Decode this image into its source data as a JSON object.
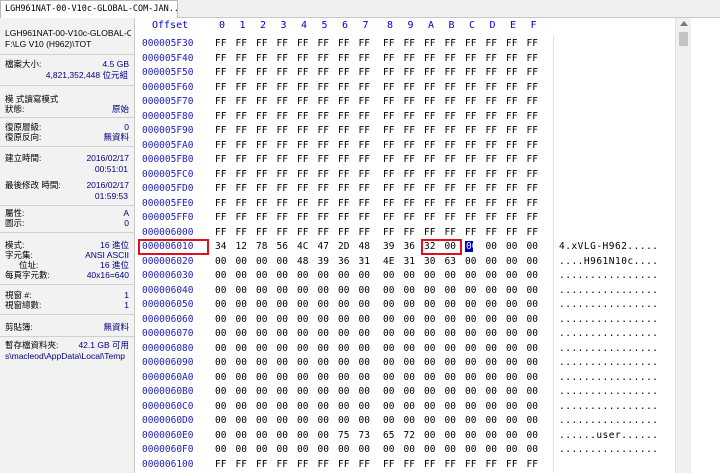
{
  "tab": {
    "title": "LGH961NAT-00-V10c-GLOBAL-COM-JAN..."
  },
  "side": {
    "file_name": "LGH961NAT-00-V10c-GLOBAL-C",
    "file_path": "F:\\LG V10 (H962)\\TOT",
    "size_label": "檔案大小:",
    "size_gb": "4.5 GB",
    "size_bytes": "4,821,352,448 位元組",
    "mode_label": "模   式讀寫模式",
    "state_label": "狀態:",
    "state_value": "原始",
    "undo_level_label": "復原層級:",
    "undo_level_value": "0",
    "undo_rev_label": "復原反向:",
    "undo_rev_value": "無資料",
    "created_label": "建立時間:",
    "created_date": "2016/02/17",
    "created_time": "00:51:01",
    "modified_label": "最後修改   時間:",
    "modified_date": "2016/02/17",
    "modified_time": "01:59:53",
    "attr_label": "屬性:",
    "attr_value": "A",
    "icon_label": "圖示:",
    "icon_value": "0",
    "mode2_label": "模式:",
    "mode2_value": "16 進位",
    "charset_label": "字元集:",
    "charset_value": "ANSI ASCII",
    "offset_label": "位址:",
    "offset_value": "16 進位",
    "bpp_label": "每頁字元數:",
    "bpp_value": "40x16=640",
    "window_label": "視窗 #:",
    "window_value": "1",
    "window_count_label": "視窗總數:",
    "window_count_value": "1",
    "clipboard_label": "剪貼簿:",
    "clipboard_value": "無資料",
    "temp_label": "暫存檔資料夾:",
    "temp_value": "42.1 GB 可用",
    "temp_path": "s\\macleod\\AppData\\Local\\Temp"
  },
  "hex": {
    "header_offset": "Offset",
    "columns": [
      "0",
      "1",
      "2",
      "3",
      "4",
      "5",
      "6",
      "7",
      "8",
      "9",
      "A",
      "B",
      "C",
      "D",
      "E",
      "F"
    ],
    "rows": [
      {
        "offset": "000005F30",
        "bytes": [
          "FF",
          "FF",
          "FF",
          "FF",
          "FF",
          "FF",
          "FF",
          "FF",
          "FF",
          "FF",
          "FF",
          "FF",
          "FF",
          "FF",
          "FF",
          "FF"
        ],
        "ascii": ""
      },
      {
        "offset": "000005F40",
        "bytes": [
          "FF",
          "FF",
          "FF",
          "FF",
          "FF",
          "FF",
          "FF",
          "FF",
          "FF",
          "FF",
          "FF",
          "FF",
          "FF",
          "FF",
          "FF",
          "FF"
        ],
        "ascii": ""
      },
      {
        "offset": "000005F50",
        "bytes": [
          "FF",
          "FF",
          "FF",
          "FF",
          "FF",
          "FF",
          "FF",
          "FF",
          "FF",
          "FF",
          "FF",
          "FF",
          "FF",
          "FF",
          "FF",
          "FF"
        ],
        "ascii": ""
      },
      {
        "offset": "000005F60",
        "bytes": [
          "FF",
          "FF",
          "FF",
          "FF",
          "FF",
          "FF",
          "FF",
          "FF",
          "FF",
          "FF",
          "FF",
          "FF",
          "FF",
          "FF",
          "FF",
          "FF"
        ],
        "ascii": ""
      },
      {
        "offset": "000005F70",
        "bytes": [
          "FF",
          "FF",
          "FF",
          "FF",
          "FF",
          "FF",
          "FF",
          "FF",
          "FF",
          "FF",
          "FF",
          "FF",
          "FF",
          "FF",
          "FF",
          "FF"
        ],
        "ascii": ""
      },
      {
        "offset": "000005F80",
        "bytes": [
          "FF",
          "FF",
          "FF",
          "FF",
          "FF",
          "FF",
          "FF",
          "FF",
          "FF",
          "FF",
          "FF",
          "FF",
          "FF",
          "FF",
          "FF",
          "FF"
        ],
        "ascii": ""
      },
      {
        "offset": "000005F90",
        "bytes": [
          "FF",
          "FF",
          "FF",
          "FF",
          "FF",
          "FF",
          "FF",
          "FF",
          "FF",
          "FF",
          "FF",
          "FF",
          "FF",
          "FF",
          "FF",
          "FF"
        ],
        "ascii": ""
      },
      {
        "offset": "000005FA0",
        "bytes": [
          "FF",
          "FF",
          "FF",
          "FF",
          "FF",
          "FF",
          "FF",
          "FF",
          "FF",
          "FF",
          "FF",
          "FF",
          "FF",
          "FF",
          "FF",
          "FF"
        ],
        "ascii": ""
      },
      {
        "offset": "000005FB0",
        "bytes": [
          "FF",
          "FF",
          "FF",
          "FF",
          "FF",
          "FF",
          "FF",
          "FF",
          "FF",
          "FF",
          "FF",
          "FF",
          "FF",
          "FF",
          "FF",
          "FF"
        ],
        "ascii": ""
      },
      {
        "offset": "000005FC0",
        "bytes": [
          "FF",
          "FF",
          "FF",
          "FF",
          "FF",
          "FF",
          "FF",
          "FF",
          "FF",
          "FF",
          "FF",
          "FF",
          "FF",
          "FF",
          "FF",
          "FF"
        ],
        "ascii": ""
      },
      {
        "offset": "000005FD0",
        "bytes": [
          "FF",
          "FF",
          "FF",
          "FF",
          "FF",
          "FF",
          "FF",
          "FF",
          "FF",
          "FF",
          "FF",
          "FF",
          "FF",
          "FF",
          "FF",
          "FF"
        ],
        "ascii": ""
      },
      {
        "offset": "000005FE0",
        "bytes": [
          "FF",
          "FF",
          "FF",
          "FF",
          "FF",
          "FF",
          "FF",
          "FF",
          "FF",
          "FF",
          "FF",
          "FF",
          "FF",
          "FF",
          "FF",
          "FF"
        ],
        "ascii": ""
      },
      {
        "offset": "000005FF0",
        "bytes": [
          "FF",
          "FF",
          "FF",
          "FF",
          "FF",
          "FF",
          "FF",
          "FF",
          "FF",
          "FF",
          "FF",
          "FF",
          "FF",
          "FF",
          "FF",
          "FF"
        ],
        "ascii": ""
      },
      {
        "offset": "000006000",
        "bytes": [
          "FF",
          "FF",
          "FF",
          "FF",
          "FF",
          "FF",
          "FF",
          "FF",
          "FF",
          "FF",
          "FF",
          "FF",
          "FF",
          "FF",
          "FF",
          "FF"
        ],
        "ascii": ""
      },
      {
        "offset": "000006010",
        "bytes": [
          "34",
          "12",
          "78",
          "56",
          "4C",
          "47",
          "2D",
          "48",
          "39",
          "36",
          "32",
          "00",
          "00",
          "00",
          "00",
          "00"
        ],
        "ascii": "4.xVLG-H962....."
      },
      {
        "offset": "000006020",
        "bytes": [
          "00",
          "00",
          "00",
          "00",
          "48",
          "39",
          "36",
          "31",
          "4E",
          "31",
          "30",
          "63",
          "00",
          "00",
          "00",
          "00"
        ],
        "ascii": "....H961N10c...."
      },
      {
        "offset": "000006030",
        "bytes": [
          "00",
          "00",
          "00",
          "00",
          "00",
          "00",
          "00",
          "00",
          "00",
          "00",
          "00",
          "00",
          "00",
          "00",
          "00",
          "00"
        ],
        "ascii": "................"
      },
      {
        "offset": "000006040",
        "bytes": [
          "00",
          "00",
          "00",
          "00",
          "00",
          "00",
          "00",
          "00",
          "00",
          "00",
          "00",
          "00",
          "00",
          "00",
          "00",
          "00"
        ],
        "ascii": "................"
      },
      {
        "offset": "000006050",
        "bytes": [
          "00",
          "00",
          "00",
          "00",
          "00",
          "00",
          "00",
          "00",
          "00",
          "00",
          "00",
          "00",
          "00",
          "00",
          "00",
          "00"
        ],
        "ascii": "................"
      },
      {
        "offset": "000006060",
        "bytes": [
          "00",
          "00",
          "00",
          "00",
          "00",
          "00",
          "00",
          "00",
          "00",
          "00",
          "00",
          "00",
          "00",
          "00",
          "00",
          "00"
        ],
        "ascii": "................"
      },
      {
        "offset": "000006070",
        "bytes": [
          "00",
          "00",
          "00",
          "00",
          "00",
          "00",
          "00",
          "00",
          "00",
          "00",
          "00",
          "00",
          "00",
          "00",
          "00",
          "00"
        ],
        "ascii": "................"
      },
      {
        "offset": "000006080",
        "bytes": [
          "00",
          "00",
          "00",
          "00",
          "00",
          "00",
          "00",
          "00",
          "00",
          "00",
          "00",
          "00",
          "00",
          "00",
          "00",
          "00"
        ],
        "ascii": "................"
      },
      {
        "offset": "000006090",
        "bytes": [
          "00",
          "00",
          "00",
          "00",
          "00",
          "00",
          "00",
          "00",
          "00",
          "00",
          "00",
          "00",
          "00",
          "00",
          "00",
          "00"
        ],
        "ascii": "................"
      },
      {
        "offset": "0000060A0",
        "bytes": [
          "00",
          "00",
          "00",
          "00",
          "00",
          "00",
          "00",
          "00",
          "00",
          "00",
          "00",
          "00",
          "00",
          "00",
          "00",
          "00"
        ],
        "ascii": "................"
      },
      {
        "offset": "0000060B0",
        "bytes": [
          "00",
          "00",
          "00",
          "00",
          "00",
          "00",
          "00",
          "00",
          "00",
          "00",
          "00",
          "00",
          "00",
          "00",
          "00",
          "00"
        ],
        "ascii": "................"
      },
      {
        "offset": "0000060C0",
        "bytes": [
          "00",
          "00",
          "00",
          "00",
          "00",
          "00",
          "00",
          "00",
          "00",
          "00",
          "00",
          "00",
          "00",
          "00",
          "00",
          "00"
        ],
        "ascii": "................"
      },
      {
        "offset": "0000060D0",
        "bytes": [
          "00",
          "00",
          "00",
          "00",
          "00",
          "00",
          "00",
          "00",
          "00",
          "00",
          "00",
          "00",
          "00",
          "00",
          "00",
          "00"
        ],
        "ascii": "................"
      },
      {
        "offset": "0000060E0",
        "bytes": [
          "00",
          "00",
          "00",
          "00",
          "00",
          "00",
          "75",
          "73",
          "65",
          "72",
          "00",
          "00",
          "00",
          "00",
          "00",
          "00"
        ],
        "ascii": "......user......"
      },
      {
        "offset": "0000060F0",
        "bytes": [
          "00",
          "00",
          "00",
          "00",
          "00",
          "00",
          "00",
          "00",
          "00",
          "00",
          "00",
          "00",
          "00",
          "00",
          "00",
          "00"
        ],
        "ascii": "................"
      },
      {
        "offset": "000006100",
        "bytes": [
          "FF",
          "FF",
          "FF",
          "FF",
          "FF",
          "FF",
          "FF",
          "FF",
          "FF",
          "FF",
          "FF",
          "FF",
          "FF",
          "FF",
          "FF",
          "FF"
        ],
        "ascii": ""
      }
    ],
    "highlight_offset_row": 14,
    "highlight_bytes": {
      "row": 14,
      "from": 10,
      "to": 11
    },
    "cursor": {
      "row": 14,
      "col": 12
    },
    "colors": {
      "highlight_box": "#e0101c",
      "cursor_bg": "#0000c8",
      "offset_text": "#2020c0"
    }
  }
}
